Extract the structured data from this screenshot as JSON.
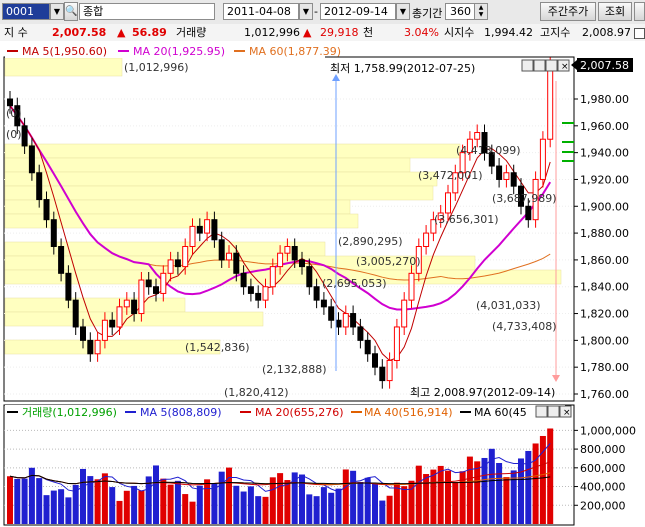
{
  "toolbar": {
    "code": "0001",
    "market": "종합",
    "start_date": "2011-04-08",
    "end_date": "2012-09-14",
    "period_label": "총기간",
    "period_count": "360",
    "weekly_btn": "주간주가",
    "query_btn": "조회"
  },
  "info": {
    "index_label": "지 수",
    "current": "2,007.58",
    "change_arrow": "▲",
    "change": "56.89",
    "volume_label": "거래량",
    "volume": "1,012,996",
    "vol_arrow": "▲",
    "vol_change": "29,918",
    "vol_unit": "천",
    "pct": "3.04%",
    "open_label": "시지수",
    "open": "1,994.42",
    "high_label": "고지수",
    "high": "2,008.97"
  },
  "price_panel": {
    "legend": {
      "ma5": "MA 5(1,950.60)",
      "ma20": "MA 20(1,925.95)",
      "ma60": "MA 60(1,877.39)"
    },
    "low_note": "최저 1,758.99(2012-07-25)",
    "high_note": "최고 2,008.97(2012-09-14)",
    "last_price_tag": "2,007.58",
    "y_ticks": [
      "1,980.00",
      "1,960.00",
      "1,940.00",
      "1,920.00",
      "1,900.00",
      "1,880.00",
      "1,860.00",
      "1,840.00",
      "1,820.00",
      "1,800.00",
      "1,780.00",
      "1,760.00"
    ],
    "volume_profile": [
      {
        "label": "(1,012,996)"
      },
      {
        "label": "(4,413,099)"
      },
      {
        "label": "(3,472,001)"
      },
      {
        "label": "(3,687,989)"
      },
      {
        "label": "(3,656,301)"
      },
      {
        "label": "(2,890,295)"
      },
      {
        "label": "(3,005,270)"
      },
      {
        "label": "(2,695,053)"
      },
      {
        "label": "(4,031,033)"
      },
      {
        "label": "(4,733,408)"
      },
      {
        "label": "(1,542,836)"
      },
      {
        "label": "(2,132,888)"
      },
      {
        "label": "(1,820,412)"
      },
      {
        "label": "(0)"
      },
      {
        "label": "(0)"
      }
    ],
    "colors": {
      "up": "#ff0000",
      "down": "#000000",
      "ma5": "#c00000",
      "ma20": "#d000d0",
      "ma60": "#e07020",
      "profile": "#ffffc0"
    }
  },
  "volume_panel": {
    "legend": {
      "vol": "거래량(1,012,996)",
      "ma5": "MA 5(808,809)",
      "ma20": "MA 20(655,276)",
      "ma40": "MA 40(516,914)",
      "ma60": "MA 60(45"
    },
    "y_ticks": [
      "1,000,000",
      "800,000",
      "600,000",
      "400,000",
      "200,000"
    ],
    "colors": {
      "up": "#e00000",
      "down": "#2020d0",
      "ma5": "#2020d0",
      "ma20": "#d00000",
      "ma40": "#e06000",
      "ma60": "#000000"
    }
  }
}
